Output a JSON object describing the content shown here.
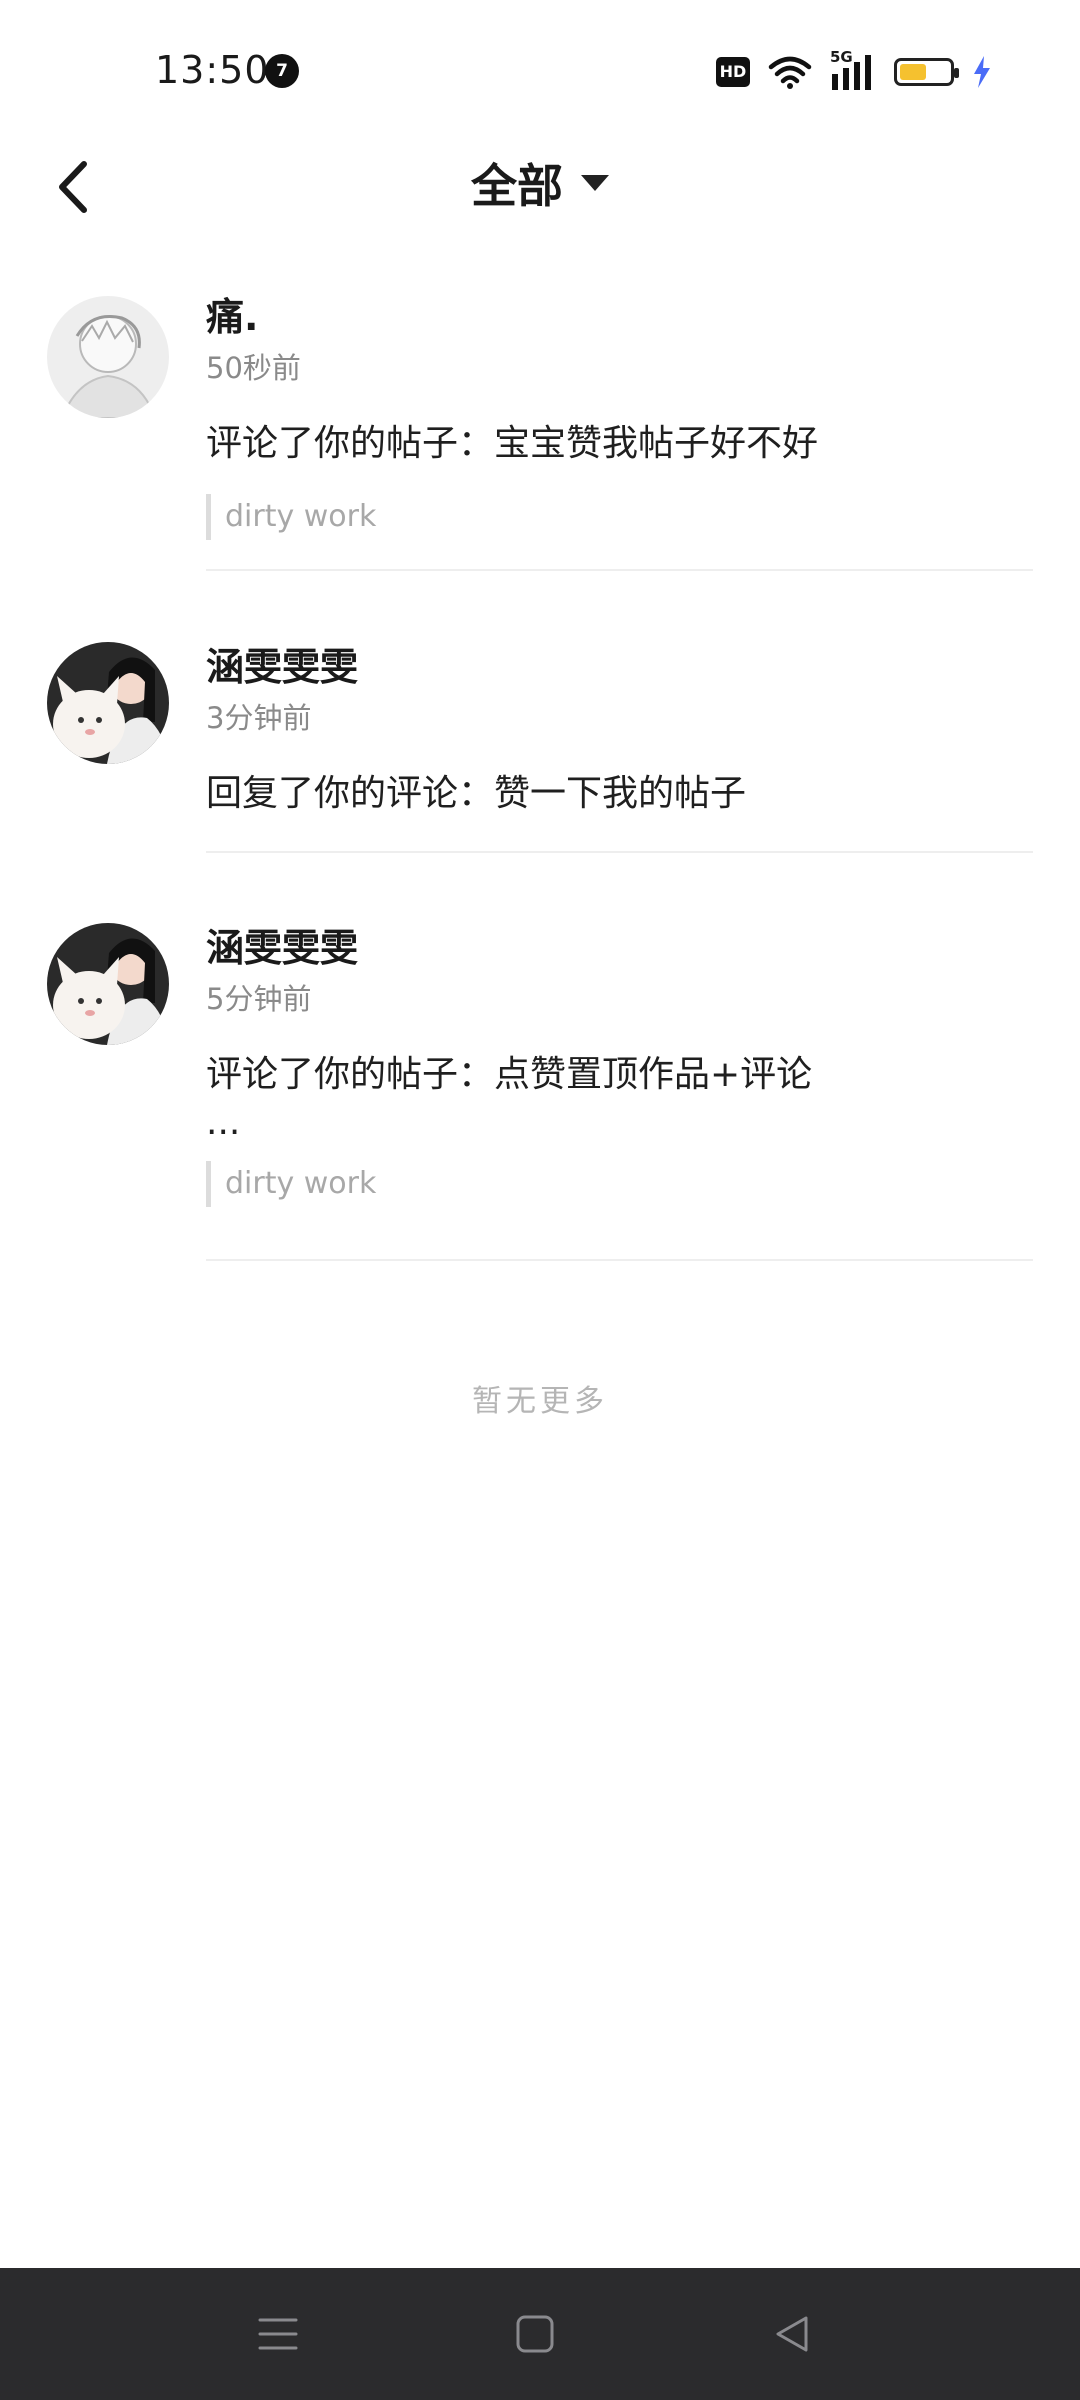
{
  "status_bar": {
    "time": "13:50",
    "notification_count": "7",
    "hd_label": "HD",
    "network_label": "5G",
    "battery_level": 0.6,
    "battery_color": "#f5c12f",
    "charging_color": "#4a6cf7"
  },
  "header": {
    "title": "全部",
    "back_icon": "chevron-left-icon",
    "dropdown_icon": "caret-down-icon"
  },
  "notifications": [
    {
      "name": "痛.",
      "time": "50秒前",
      "message": "评论了你的帖子：宝宝赞我帖子好不好",
      "quote": "dirty work"
    },
    {
      "name": "涵雯雯雯",
      "time": "3分钟前",
      "message": "回复了你的评论：赞一下我的帖子"
    },
    {
      "name": "涵雯雯雯",
      "time": "5分钟前",
      "message": "评论了你的帖子：点赞置顶作品+评论",
      "message_more": "...",
      "quote": "dirty work"
    }
  ],
  "footer_text": "暂无更多",
  "system_nav": {
    "menu_icon": "menu-icon",
    "home_icon": "square-home-icon",
    "back_icon": "triangle-back-icon"
  }
}
